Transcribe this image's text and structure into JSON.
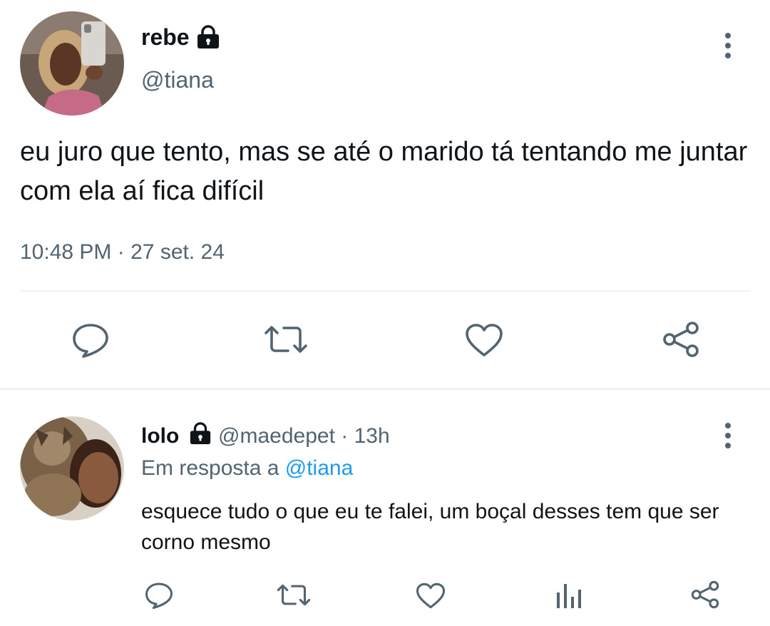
{
  "main_tweet": {
    "author_name": "rebe",
    "author_handle": "@tiana",
    "text": "eu juro que tento, mas se até o marido tá tentando me juntar com ela aí fica difícil",
    "time": "10:48 PM",
    "date_separator": "·",
    "date": "27 set. 24",
    "icons": {
      "lock": "lock-icon",
      "more": "more-vertical-icon",
      "reply": "reply-icon",
      "retweet": "retweet-icon",
      "like": "heart-icon",
      "share": "share-icon"
    }
  },
  "reply": {
    "author_name": "lolo",
    "author_handle": "@maedepet",
    "time_separator": "·",
    "time": "13h",
    "in_reply_prefix": "Em resposta a",
    "in_reply_handle": "@tiana",
    "text": "esquece tudo o que eu te falei, um boçal desses tem que ser corno mesmo",
    "icons": {
      "lock": "lock-icon",
      "more": "more-vertical-icon",
      "reply": "reply-icon",
      "retweet": "retweet-icon",
      "like": "heart-icon",
      "views": "analytics-icon",
      "share": "share-icon"
    }
  },
  "colors": {
    "text": "#0f1419",
    "secondary": "#536471",
    "link": "#1d9bf0",
    "divider": "#eff3f4"
  }
}
